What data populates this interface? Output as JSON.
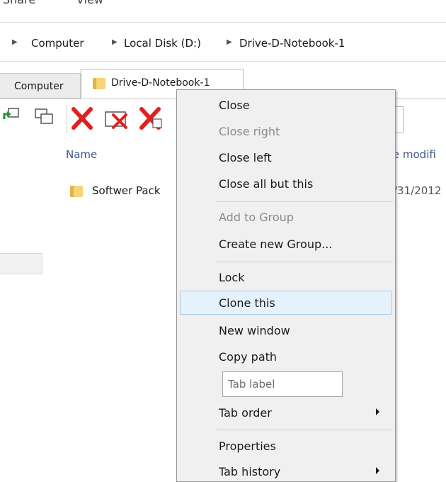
{
  "ribbon": {
    "tabs": [
      "Share",
      "View"
    ]
  },
  "address": {
    "crumbs": [
      "Computer",
      "Local Disk (D:)",
      "Drive-D-Notebook-1"
    ]
  },
  "tabs": {
    "inactive_label": "Computer",
    "active_label": "Drive-D-Notebook-1"
  },
  "toolbar": {
    "icons": [
      "move-to-icon",
      "copy-to-icon",
      "delete-icon",
      "delete-dialog-icon",
      "permanent-delete-icon"
    ]
  },
  "file_list": {
    "columns": [
      "Name",
      "te modifi"
    ],
    "rows": [
      {
        "name": "Softwer Pack",
        "date": "/31/2012"
      }
    ]
  },
  "context_menu": {
    "items": [
      {
        "label": "Close",
        "enabled": true
      },
      {
        "label": "Close right",
        "enabled": false
      },
      {
        "label": "Close left",
        "enabled": true
      },
      {
        "label": "Close all but this",
        "enabled": true
      },
      {
        "label": "Add to Group",
        "enabled": false
      },
      {
        "label": "Create new Group...",
        "enabled": true
      },
      {
        "label": "Lock",
        "enabled": true
      },
      {
        "label": "Clone this",
        "enabled": true,
        "highlighted": true
      },
      {
        "label": "New window",
        "enabled": true
      },
      {
        "label": "Copy path",
        "enabled": true
      },
      {
        "label": "Tab order",
        "enabled": true,
        "submenu": true
      },
      {
        "label": "Properties",
        "enabled": true
      },
      {
        "label": "Tab history",
        "enabled": true,
        "submenu": true
      }
    ],
    "tab_label_placeholder": "Tab label"
  },
  "colors": {
    "menu_highlight": "#e5f1fb",
    "menu_background": "#f0f0f0",
    "folder": "#f6d477",
    "delete_red": "#e02020"
  }
}
